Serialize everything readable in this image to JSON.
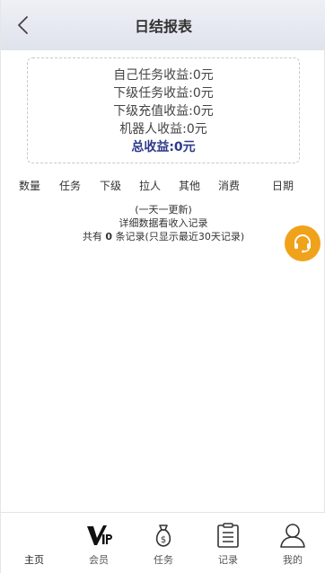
{
  "header": {
    "title": "日结报表"
  },
  "summary": {
    "self_task": "自己任务收益:0元",
    "sub_task": "下级任务收益:0元",
    "sub_recharge": "下级充值收益:0元",
    "robot": "机器人收益:0元",
    "total": "总收益:0元"
  },
  "columns": [
    "数量",
    "任务",
    "下级",
    "拉人",
    "其他",
    "消费",
    "日期"
  ],
  "notes": {
    "update": "(一天一更新)",
    "detail": "详细数据看收入记录",
    "count_prefix": "共有",
    "count": "0",
    "count_suffix": "条记录(只显示最近30天记录)"
  },
  "tabbar": {
    "items": [
      {
        "label": "主页",
        "icon": "home-icon"
      },
      {
        "label": "会员",
        "icon": "vip-icon"
      },
      {
        "label": "任务",
        "icon": "money-bag-icon"
      },
      {
        "label": "记录",
        "icon": "clipboard-icon"
      },
      {
        "label": "我的",
        "icon": "user-icon"
      }
    ]
  },
  "colors": {
    "accent": "#f0a21b",
    "total_text": "#2e3a8c"
  }
}
